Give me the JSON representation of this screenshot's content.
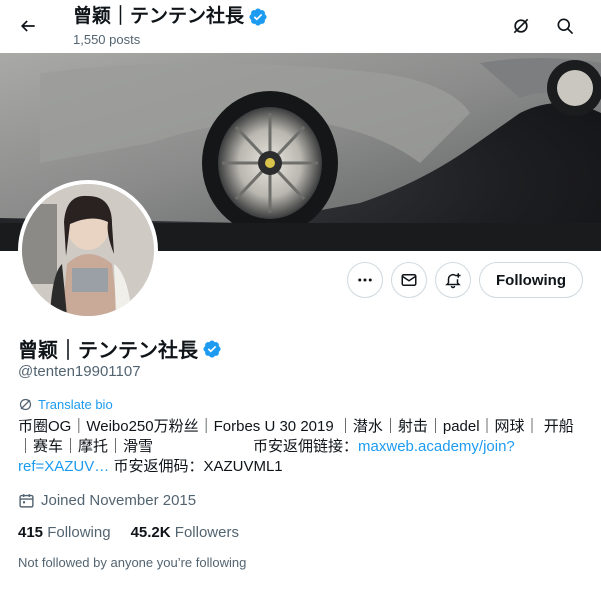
{
  "header": {
    "name": "曾颖｜テンテン社長",
    "posts_count": "1,550 posts"
  },
  "profile": {
    "name": "曾颖｜テンテン社長",
    "handle": "@tenten19901107",
    "following_button": "Following",
    "translate_bio": "Translate bio",
    "bio_line1": "币圈OG｜Weibo250万粉丝｜Forbes U 30 2019 ｜潜水｜射击｜padel｜网球｜ 开船",
    "bio_line2a": "｜赛车｜摩托｜滑雪",
    "bio_line2b": "币安返佣链接：",
    "bio_link_part1": "maxweb.academy/join?",
    "bio_link_part2": "ref=XAZUV…",
    "bio_line3_rest": " 币安返佣码：XAZUVML1",
    "joined": "Joined November 2015",
    "following_count": "415",
    "following_label": "Following",
    "followers_count": "45.2K",
    "followers_label": "Followers",
    "not_followed": "Not followed by anyone you’re following"
  },
  "colors": {
    "accent": "#1d9bf0",
    "secondary_text": "#536471",
    "border": "#cfd9de"
  },
  "icons": [
    "back-arrow-icon",
    "verified-badge-icon",
    "grok-icon",
    "search-icon",
    "more-icon",
    "message-icon",
    "notification-bell-icon",
    "translate-icon",
    "calendar-icon"
  ]
}
